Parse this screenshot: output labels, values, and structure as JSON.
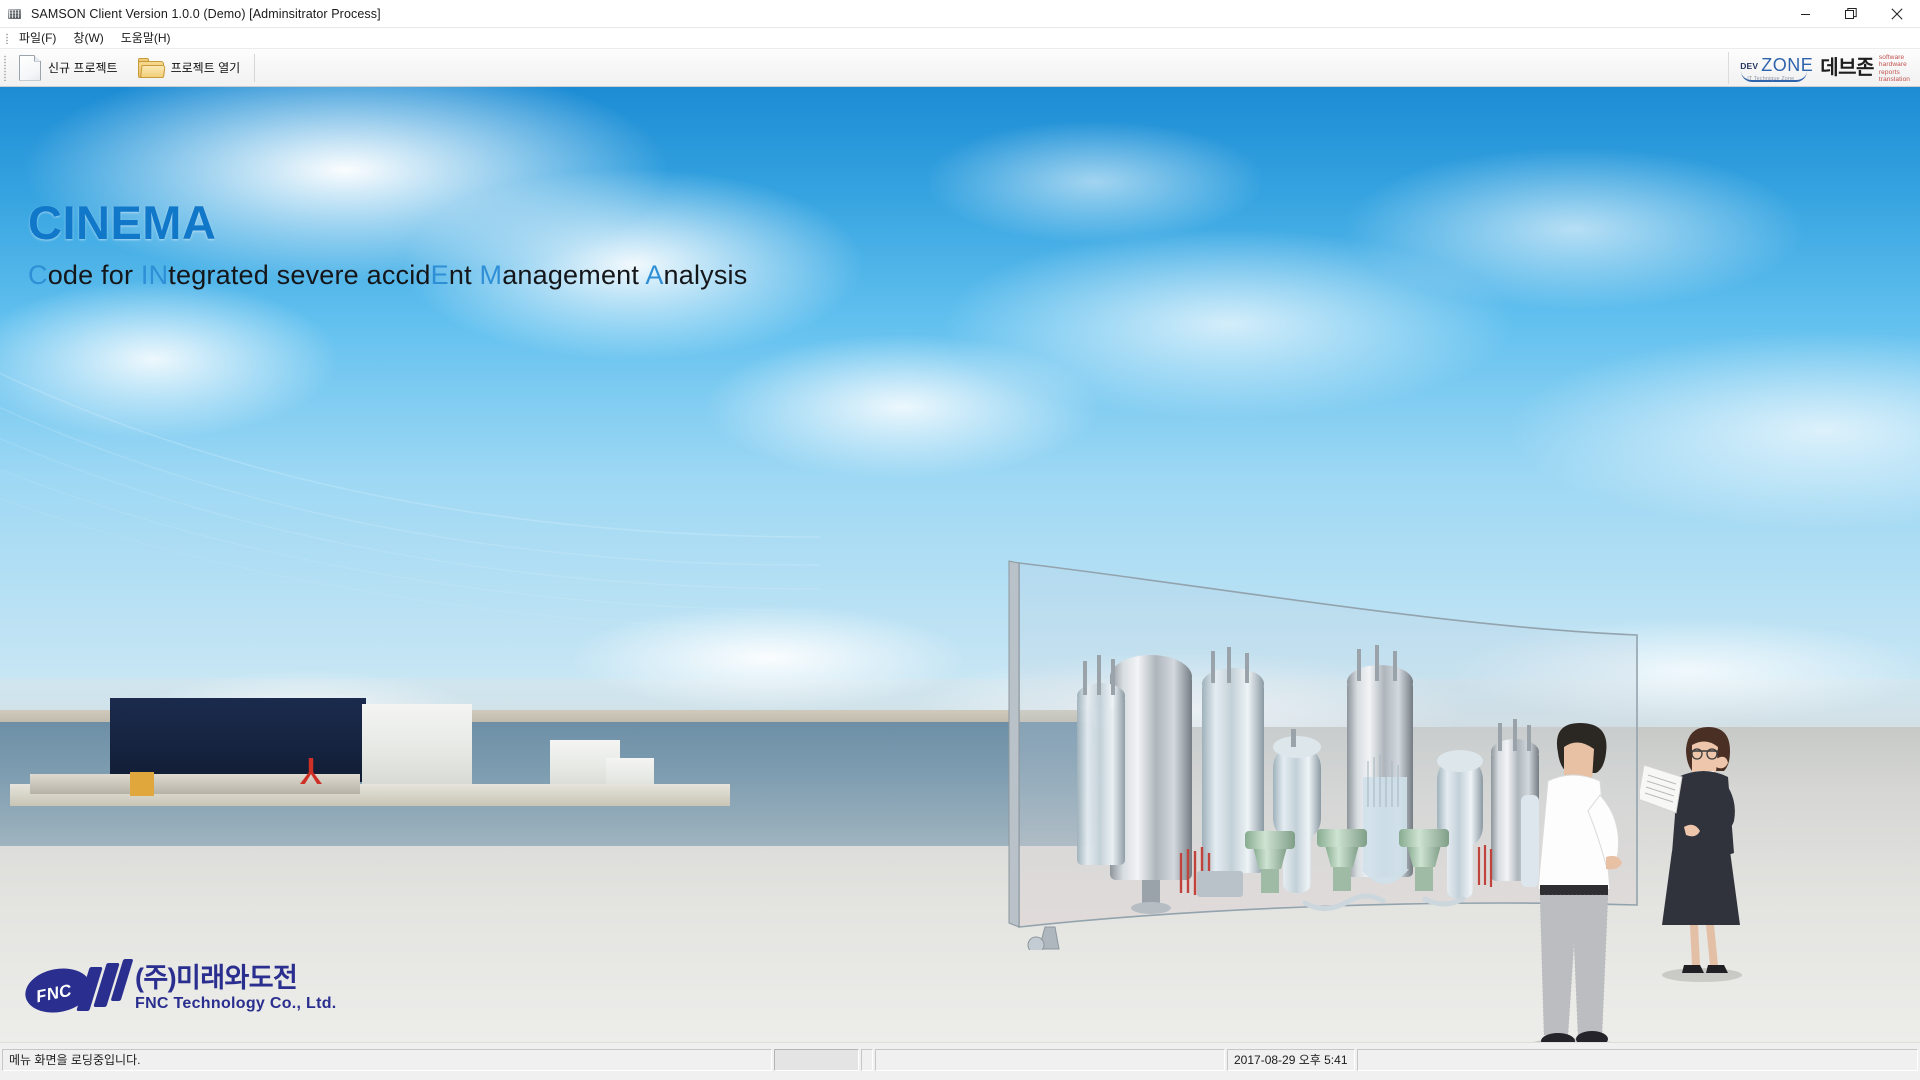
{
  "window": {
    "title": "SAMSON Client Version 1.0.0 (Demo) [Adminsitrator Process]",
    "app_icon": "application-icon",
    "minimize_label": "─",
    "maximize_label": "restore-icon",
    "close_label": "✕"
  },
  "menubar": {
    "items": [
      {
        "label": "파일(F)",
        "name": "menu-file"
      },
      {
        "label": "창(W)",
        "name": "menu-window"
      },
      {
        "label": "도움말(H)",
        "name": "menu-help"
      }
    ]
  },
  "toolbar": {
    "new_project_label": "신규 프로젝트",
    "new_project_icon": "page-icon",
    "open_project_label": "프로젝트 열기",
    "open_project_icon": "folder-icon",
    "devzone": {
      "dev": "DEV",
      "zone": "ZONE",
      "tagline": "IT Technique Zone",
      "korean": "데브존",
      "tags": [
        "software",
        "hardware",
        "reports",
        "translation"
      ]
    }
  },
  "splash": {
    "brand": "CINEMA",
    "subtitle_parts": [
      {
        "text": "C",
        "accent": true
      },
      {
        "text": "ode for ",
        "accent": false
      },
      {
        "text": "IN",
        "accent": true
      },
      {
        "text": "tegrated severe accid",
        "accent": false
      },
      {
        "text": "E",
        "accent": true
      },
      {
        "text": "nt ",
        "accent": false
      },
      {
        "text": "M",
        "accent": true
      },
      {
        "text": "anagement ",
        "accent": false
      },
      {
        "text": "A",
        "accent": true
      },
      {
        "text": "nalysis",
        "accent": false
      }
    ],
    "subtitle_full": "Code for INtegrated severe accidEnt Management Analysis",
    "accent_color": "#2f8fd6",
    "brand_color": "#1177c9",
    "company": {
      "mark_text": "FNC",
      "korean": "(주)미래와도전",
      "english": "FNC Technology Co., Ltd.",
      "color": "#2a2f8f"
    },
    "scene_description": "nuclear-power-plant-photo-with-curved-transparent-display-and-two-engineers"
  },
  "statusbar": {
    "message": "메뉴 화면을 로딩중입니다.",
    "progress": "",
    "spacer": "",
    "panel": "",
    "timestamp": "2017-08-29 오후 5:41",
    "tail": ""
  }
}
